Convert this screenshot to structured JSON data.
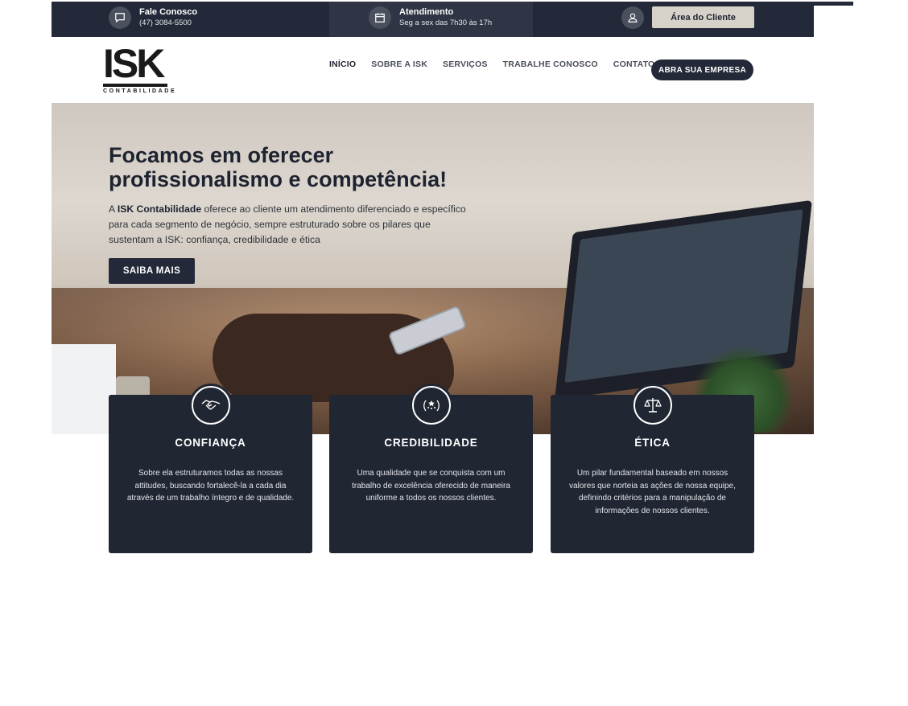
{
  "topbar": {
    "contact": {
      "icon": "chat-bubble-icon",
      "title": "Fale Conosco",
      "subtitle": "(47) 3084-5500"
    },
    "hours": {
      "icon": "calendar-icon",
      "title": "Atendimento",
      "subtitle": "Seg a sex das 7h30 às 17h"
    },
    "client": {
      "icon": "user-icon",
      "button_label": "Área do Cliente"
    }
  },
  "header": {
    "logo": {
      "main": "ISK",
      "sub": "CONTABILIDADE"
    },
    "nav": [
      {
        "label": "INÍCIO",
        "active": true
      },
      {
        "label": "SOBRE A ISK",
        "active": false
      },
      {
        "label": "SERVIÇOS",
        "active": false
      },
      {
        "label": "TRABALHE CONOSCO",
        "active": false
      },
      {
        "label": "CONTATO",
        "active": false
      }
    ],
    "cta_label": "ABRA SUA EMPRESA"
  },
  "hero": {
    "title_line1": "Focamos em oferecer",
    "title_line2": "profissionalismo e competência!",
    "text_prefix": "A ",
    "text_bold": "ISK Contabilidade",
    "text_rest": " oferece ao cliente um atendimento diferenciado e específico para cada segmento de negócio, sempre estruturado sobre os pilares que sustentam a ISK: confiança, credibilidade e ética",
    "button_label": "SAIBA MAIS"
  },
  "cards": [
    {
      "icon": "handshake-icon",
      "title": "CONFIANÇA",
      "text": "Sobre ela estruturamos todas as nossas attitudes, buscando fortalecê-la a cada dia através de um trabalho íntegro e de qualidade."
    },
    {
      "icon": "laurel-stars-icon",
      "title": "CREDIBILIDADE",
      "text": "Uma qualidade que se conquista com um trabalho de excelência oferecido de maneira uniforme a todos os nossos clientes."
    },
    {
      "icon": "scales-icon",
      "title": "ÉTICA",
      "text": "Um pilar fundamental baseado em nossos valores que norteia as ações de nossa equipe, definindo critérios para a manipulação de informações de nossos clientes."
    }
  ],
  "colors": {
    "dark": "#232938",
    "card": "#212633",
    "client_button": "#d6d1c9",
    "white": "#ffffff"
  }
}
